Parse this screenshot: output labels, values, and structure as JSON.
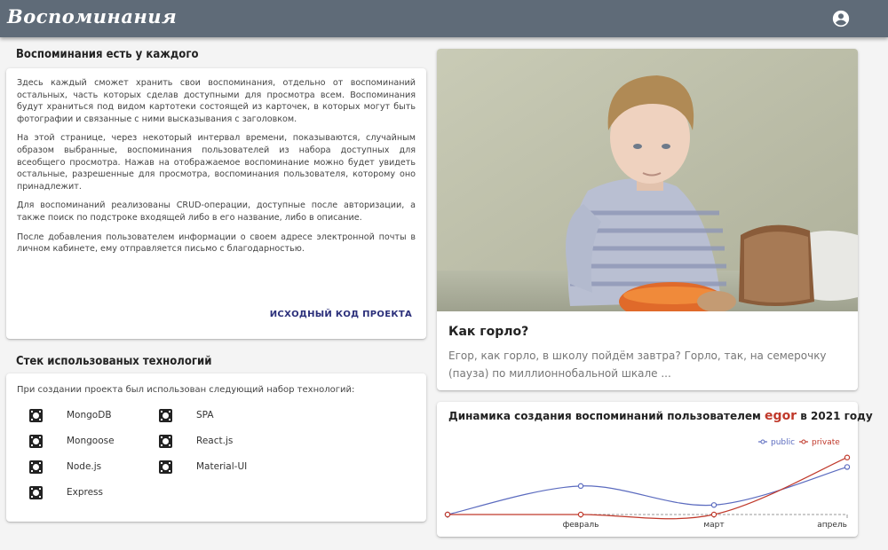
{
  "app": {
    "logo": "Воспоминания",
    "account_icon": "account-circle-icon"
  },
  "about": {
    "title": "Воспоминания есть у каждого",
    "paragraphs": [
      "Здесь каждый сможет хранить свои воспоминания, отдельно от воспоминаний остальных, часть которых сделав доступными для просмотра всем. Воспоминания будут храниться под видом картотеки состоящей из карточек, в которых могут быть фотографии и связанные с ними высказывания с заголовком.",
      "На этой странице, через некоторый интервал времени, показываются, случайным образом выбранные, воспоминания пользователей из набора доступных для всеобщего просмотра. Нажав на отображаемое воспоминание можно будет увидеть остальные, разрешенные для просмотра, воспоминания пользователя, которому оно принадлежит.",
      "Для воспоминаний реализованы CRUD-операции, доступные после авторизации, а также поиск по подстроке входящей либо в его название, либо в описание.",
      "После добавления пользователем информации о своем адресе электронной почты в личном кабинете, ему отправляется письмо с благодарностью."
    ],
    "source_link": "ИСХОДНЫЙ КОД ПРОЕКТА"
  },
  "stack": {
    "title": "Стек использованых технологий",
    "intro": "При создании проекта был использован следующий набор технологий:",
    "items": [
      "MongoDB",
      "SPA",
      "Mongoose",
      "React.js",
      "Node.js",
      "Material-UI",
      "Express"
    ],
    "icon": "tech-badge-icon"
  },
  "memory": {
    "title": "Как горло?",
    "text": "Егор, как горло, в школу пойдём завтра? Горло, так, на семерочку (пауза) по миллионнобальной шкале ...",
    "photo_description": "child-with-bread-photo"
  },
  "chart_data": {
    "type": "line",
    "title_prefix": "Динамика создания воспоминаний пользователем",
    "title_user": "egor",
    "title_suffix": "в 2021 году",
    "categories": [
      "",
      "февраль",
      "март",
      "апрель"
    ],
    "series": [
      {
        "name": "public",
        "color": "#5b6bbf",
        "values": [
          0,
          3,
          1,
          5
        ]
      },
      {
        "name": "private",
        "color": "#c0392b",
        "values": [
          0,
          0,
          0,
          6
        ]
      }
    ],
    "ylim": [
      0,
      7
    ],
    "legend_position": "top-right",
    "grid": false
  }
}
